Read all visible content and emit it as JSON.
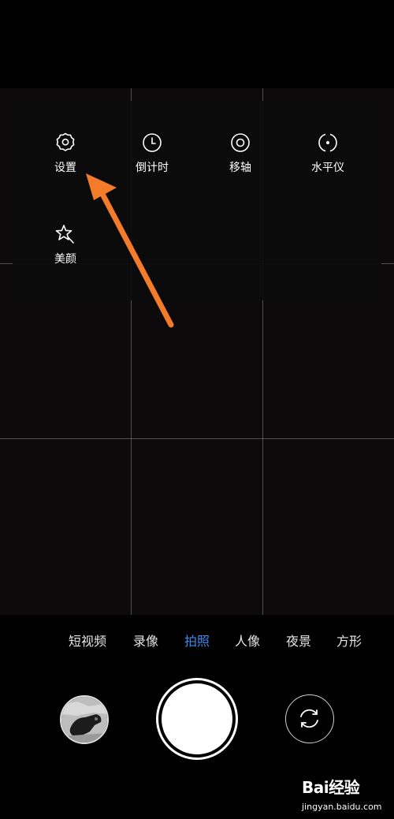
{
  "quick_menu": {
    "items": [
      {
        "label": "设置",
        "icon": "gear-icon"
      },
      {
        "label": "倒计时",
        "icon": "timer-icon"
      },
      {
        "label": "移轴",
        "icon": "tilt-shift-icon"
      },
      {
        "label": "水平仪",
        "icon": "level-icon"
      },
      {
        "label": "美颜",
        "icon": "beauty-star-icon"
      }
    ]
  },
  "modes": {
    "items": [
      "短视频",
      "录像",
      "拍照",
      "人像",
      "夜景",
      "方形"
    ],
    "active": "拍照"
  },
  "annotation": {
    "arrow_color": "#f47b2a"
  },
  "colors": {
    "accent": "#3a8ef0"
  },
  "watermark": {
    "logo_text": "Bai经验",
    "url": "jingyan.baidu.com"
  }
}
